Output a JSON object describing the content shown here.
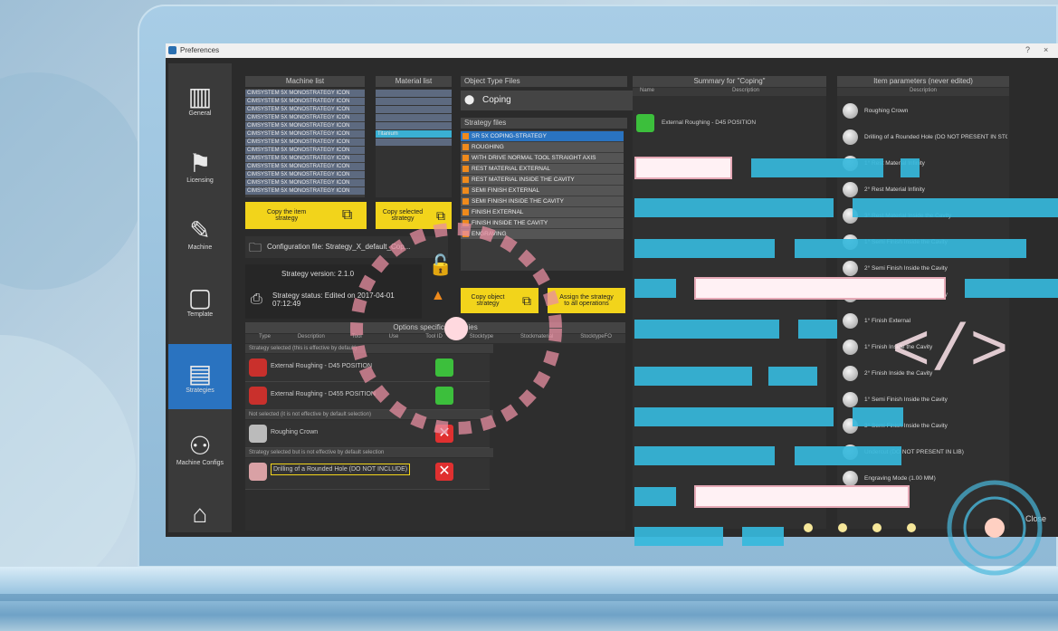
{
  "window": {
    "title": "Preferences",
    "controls": [
      "?",
      "×"
    ]
  },
  "sidebar": {
    "items": [
      {
        "label": "General",
        "icon": "bars-logo-icon"
      },
      {
        "label": "Licensing",
        "icon": "flag-icon"
      },
      {
        "label": "Machine",
        "icon": "tool-icon"
      },
      {
        "label": "Template",
        "icon": "template-icon"
      },
      {
        "label": "Strategies",
        "icon": "strategy-icon"
      },
      {
        "label": "Machine Configs",
        "icon": "config-icon"
      },
      {
        "label": "",
        "icon": "holder-icon"
      }
    ]
  },
  "machine_list": {
    "header": "Machine list",
    "items": [
      "CIMSYSTEM 5X MONOSTRATEGY ICON",
      "CIMSYSTEM 5X MONOSTRATEGY ICON",
      "CIMSYSTEM 5X MONOSTRATEGY ICON",
      "CIMSYSTEM 5X MONOSTRATEGY ICON",
      "CIMSYSTEM 5X MONOSTRATEGY ICON",
      "CIMSYSTEM 5X MONOSTRATEGY ICON",
      "CIMSYSTEM 5X MONOSTRATEGY ICON",
      "CIMSYSTEM 5X MONOSTRATEGY ICON",
      "CIMSYSTEM 5X MONOSTRATEGY ICON",
      "CIMSYSTEM 5X MONOSTRATEGY ICON",
      "CIMSYSTEM 5X MONOSTRATEGY ICON",
      "CIMSYSTEM 5X MONOSTRATEGY ICON",
      "CIMSYSTEM 5X MONOSTRATEGY ICON"
    ]
  },
  "material_list": {
    "header": "Material list",
    "items": [
      "",
      "",
      "",
      "",
      "",
      "Titanium",
      ""
    ]
  },
  "buttons": {
    "copy_item": "Copy the item strategy",
    "copy_selected": "Copy selected strategy",
    "copy_object": "Copy object strategy",
    "assign_strategy": "Assign the strategy to all operations"
  },
  "config": {
    "file_label": "Configuration file: Strategy_X_default_Cop...",
    "version": "Strategy version: 2.1.0",
    "status": "Strategy status: Edited on 2017-04-01 07:12:49"
  },
  "object_type": {
    "header": "Object Type Files",
    "selected": "Coping"
  },
  "strategy": {
    "header": "Strategy files",
    "items": [
      "SR 5X COPING-STRATEGY",
      "ROUGHING",
      "WITH DRIVE NORMAL TOOL STRAIGHT AXIS",
      "REST MATERIAL EXTERNAL",
      "REST MATERIAL INSIDE THE CAVITY",
      "SEMI FINISH EXTERNAL",
      "SEMI FINISH INSIDE THE CAVITY",
      "FINISH EXTERNAL",
      "FINISH INSIDE THE CAVITY",
      "ENGRAVING"
    ]
  },
  "options": {
    "header": "Options specific strategies",
    "columns": [
      "Type",
      "Description",
      "Tool",
      "Use",
      "Tool ID",
      "Stocktype",
      "Stockmaterial",
      "StocktypeFO"
    ],
    "section1": "Strategy selected (this is effective by default)",
    "section2": "Not selected (it is not effective by default selection)",
    "section3": "Strategy selected but is not effective by default selection",
    "rows": [
      {
        "text": "External Roughing - D45 POSITION",
        "action": "green"
      },
      {
        "text": "External Roughing - D455 POSITION",
        "action": "green"
      },
      {
        "text": "Roughing Crown",
        "action": "red"
      },
      {
        "text": "Drilling of a Rounded Hole (DO NOT INCLUDE)",
        "action": "red"
      }
    ]
  },
  "summary": {
    "header": "Summary for \"Coping\"",
    "columns": [
      "Name",
      "Description"
    ],
    "item": "External Roughing - D45 POSITION"
  },
  "item_params": {
    "header": "Item parameters (never edited)",
    "column": "Description",
    "items": [
      "Roughing Crown",
      "Drilling of a Rounded Hole (DO NOT PRESENT IN STOCK LIBRARY)",
      "1° Rest Material Infinity",
      "2° Rest Material Infinity",
      "3° Rest Material Inside the Cavity",
      "1° Semi Finish Inside the Cavity",
      "2° Semi Finish Inside the Cavity",
      "3° Semi Finish Inside the Cavity",
      "1° Finish External",
      "1° Finish Inside the Cavity",
      "2° Finish Inside the Cavity",
      "1° Semi Finish Inside the Cavity",
      "3° Semi Finish Inside the Cavity",
      "Undercut (DO NOT PRESENT IN LIB)",
      "Engraving Mode (1.00 MM)"
    ]
  },
  "close_label": "Close",
  "colors": {
    "accent": "#36b8dc",
    "highlight": "#f2d41b",
    "active": "#2a73c0"
  }
}
